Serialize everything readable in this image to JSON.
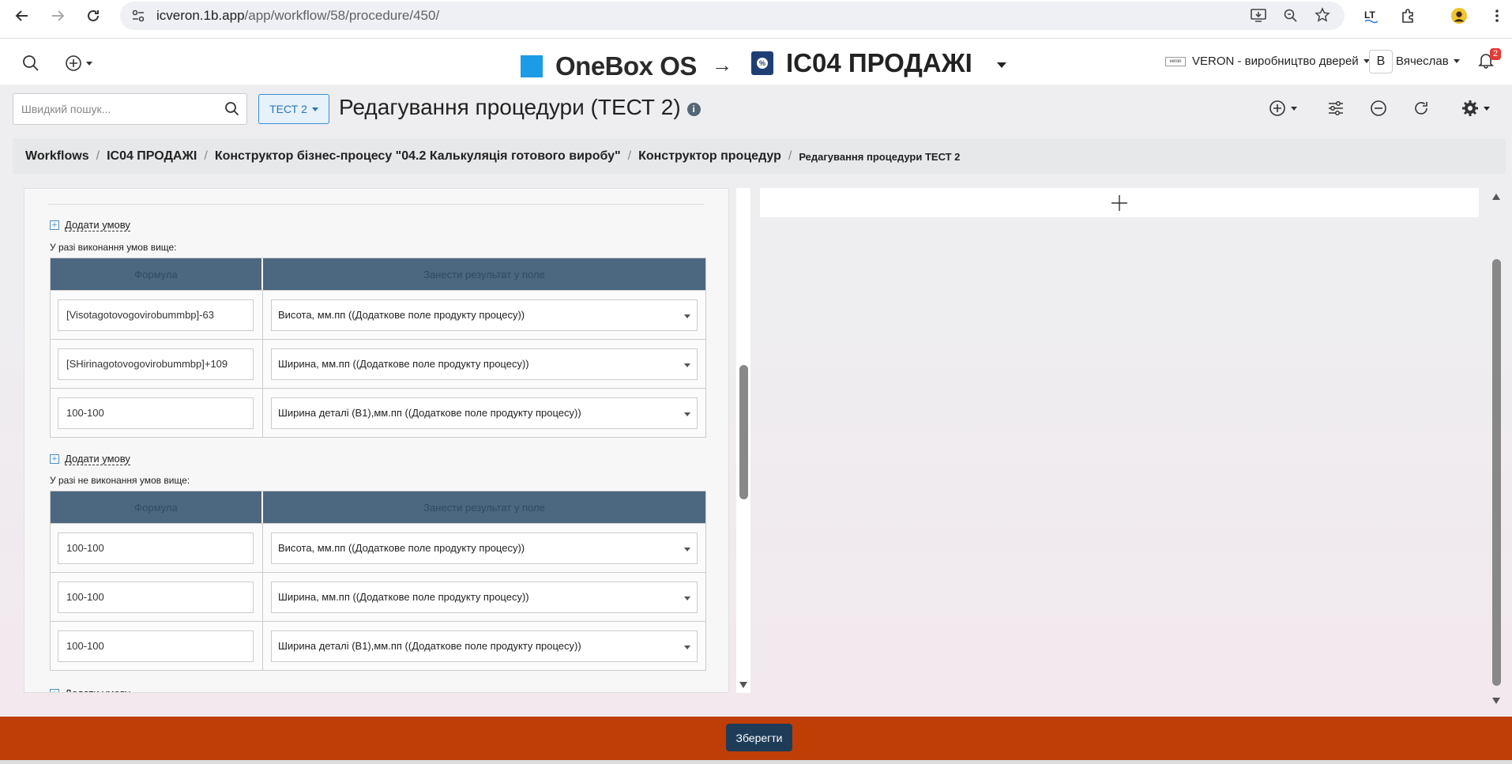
{
  "browser": {
    "url_host": "icveron.1b.app",
    "url_path": "/app/workflow/58/procedure/450/"
  },
  "header": {
    "brand": "OneBox OS",
    "workspace": "IC04 ПРОДАЖІ",
    "company": "VERON - виробництво дверей",
    "company_logo_text": "veron",
    "user_initial": "В",
    "user_name": "Вячеслав",
    "notifications": "2",
    "ws_logo_glyph": "%"
  },
  "toolbar": {
    "search_placeholder": "Швидкий пошук...",
    "tag_label": "ТЕСТ 2",
    "page_title": "Редагування процедури (ТЕСТ 2)",
    "info_glyph": "i"
  },
  "breadcrumbs": [
    "Workflows",
    "IC04 ПРОДАЖІ",
    "Конструктор бізнес-процесу \"04.2 Калькуляція готового виробу\"",
    "Конструктор процедур",
    "Редагування процедури ТЕСТ 2"
  ],
  "editor": {
    "add_condition": "Додати умову",
    "plus_glyph": "+",
    "section_true": "У разі виконання умов вище:",
    "section_false": "У разі не виконання умов вище:",
    "col_formula": "Формула",
    "col_result": "Занести результат у поле",
    "true_rows": [
      {
        "formula": "[Visotagotovogovirobummbp]-63",
        "field": "Висота, мм.пп ((Додаткове поле продукту процесу))"
      },
      {
        "formula": "[SHirinagotovogovirobummbp]+109",
        "field": "Ширина, мм.пп ((Додаткове поле продукту процесу))"
      },
      {
        "formula": "100-100",
        "field": "Ширина деталі (В1),мм.пп ((Додаткове поле продукту процесу))"
      }
    ],
    "false_rows": [
      {
        "formula": "100-100",
        "field": "Висота, мм.пп ((Додаткове поле продукту процесу))"
      },
      {
        "formula": "100-100",
        "field": "Ширина, мм.пп ((Додаткове поле продукту процесу))"
      },
      {
        "formula": "100-100",
        "field": "Ширина деталі (В1),мм.пп ((Додаткове поле продукту процесу))"
      }
    ]
  },
  "footer": {
    "save_label": "Зберегти"
  }
}
